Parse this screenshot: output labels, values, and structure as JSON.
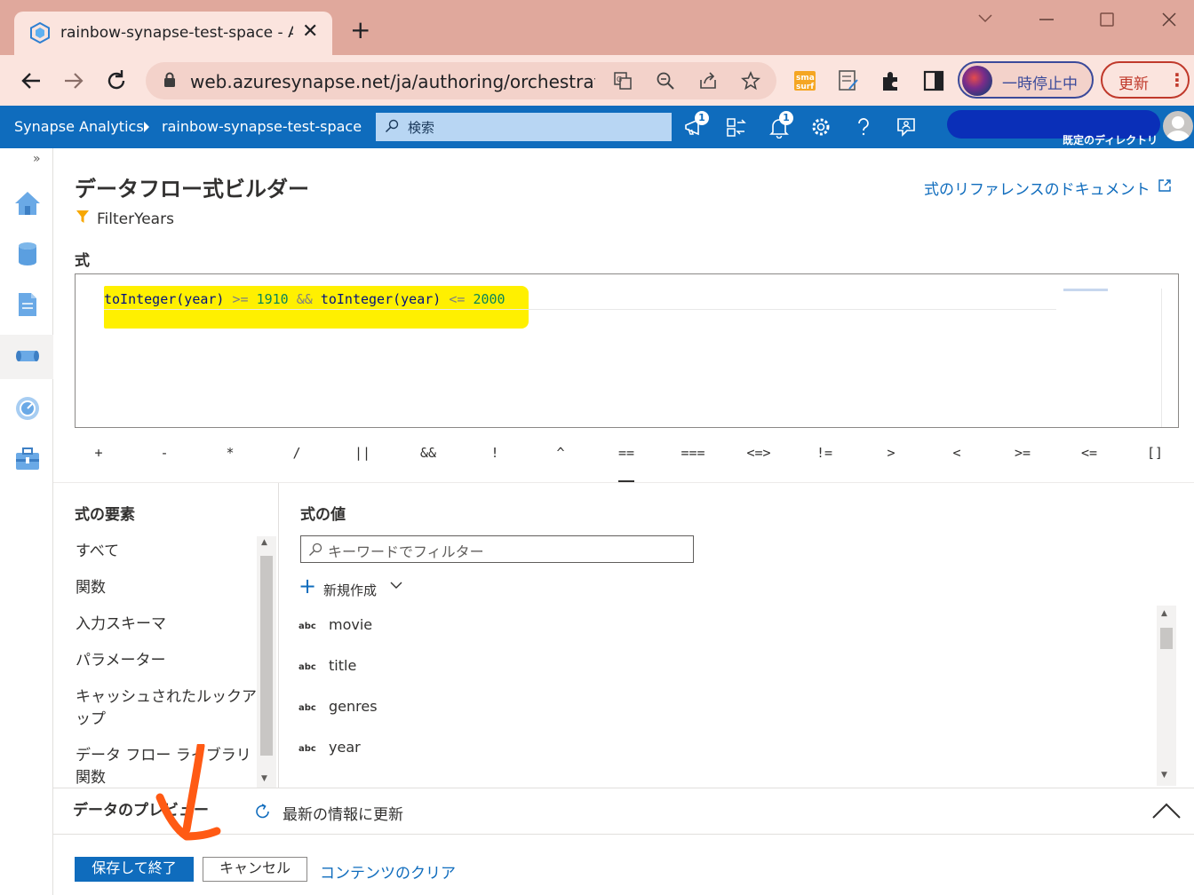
{
  "browser": {
    "tab_title": "rainbow-synapse-test-space - Az",
    "url": "web.azuresynapse.net/ja/authoring/orchestrate...",
    "profile_label": "一時停止中",
    "update_label": "更新"
  },
  "header": {
    "brand": "Synapse Analytics",
    "workspace": "rainbow-synapse-test-space",
    "search_placeholder": "検索",
    "notif_badge_1": "1",
    "notif_badge_2": "1",
    "user_tail": "既定のディレクトリ"
  },
  "builder": {
    "title": "データフロー式ビルダー",
    "doc_link": "式のリファレンスのドキュメント",
    "transform_name": "FilterYears",
    "expr_label": "式",
    "expression": {
      "fn1": "toInteger(year)",
      "op1": " >= ",
      "num1": "1910",
      "op2": " && ",
      "fn2": "toInteger(year)",
      "op3": " <= ",
      "num2": "2000"
    },
    "operators": [
      "+",
      "-",
      "*",
      "/",
      "||",
      "&&",
      "!",
      "^",
      "==",
      "===",
      "<=>",
      "!=",
      ">",
      "<",
      ">=",
      "<=",
      "[]"
    ]
  },
  "elements": {
    "title": "式の要素",
    "items": [
      "すべて",
      "関数",
      "入力スキーマ",
      "パラメーター",
      "キャッシュされたルックアップ",
      "データ フロー ライブラリ関数"
    ]
  },
  "values": {
    "title": "式の値",
    "filter_placeholder": "キーワードでフィルター",
    "new_label": "新規作成",
    "rows": [
      {
        "type": "abc",
        "name": "movie"
      },
      {
        "type": "abc",
        "name": "title"
      },
      {
        "type": "abc",
        "name": "genres"
      },
      {
        "type": "abc",
        "name": "year"
      }
    ]
  },
  "preview": {
    "title": "データのプレビュー",
    "refresh_label": "最新の情報に更新"
  },
  "footer": {
    "save_label": "保存して終了",
    "cancel_label": "キャンセル",
    "clear_label": "コンテンツのクリア"
  },
  "colors": {
    "accent": "#0f6cbd",
    "highlight": "#fff000",
    "annotation": "#ff5a14"
  }
}
